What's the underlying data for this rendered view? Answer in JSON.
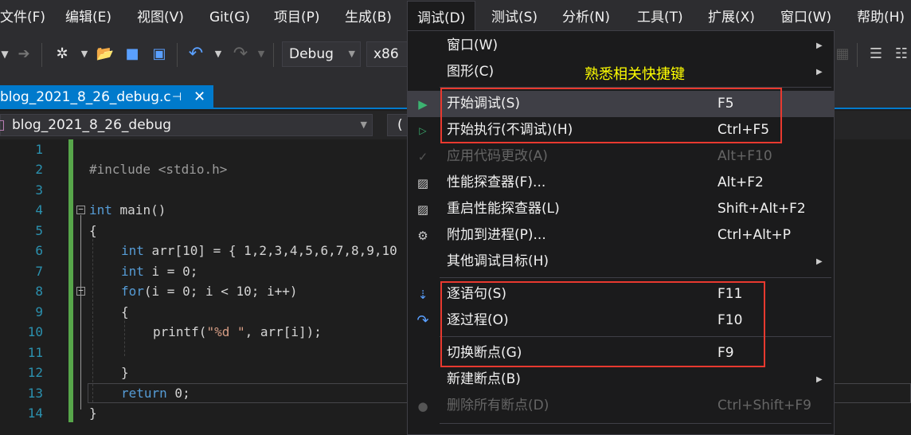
{
  "menubar": {
    "items": [
      "文件(F)",
      "编辑(E)",
      "视图(V)",
      "Git(G)",
      "项目(P)",
      "生成(B)",
      "调试(D)",
      "测试(S)",
      "分析(N)",
      "工具(T)",
      "扩展(X)",
      "窗口(W)",
      "帮助(H)"
    ]
  },
  "toolbar": {
    "config": "Debug",
    "platform": "x86"
  },
  "tab": {
    "title": "blog_2021_8_26_debug.c",
    "pin_glyph": "⊣",
    "close_glyph": "✕"
  },
  "navbar": {
    "scope": "blog_2021_8_26_debug",
    "member": "("
  },
  "editor": {
    "line_numbers": [
      "1",
      "2",
      "3",
      "4",
      "5",
      "6",
      "7",
      "8",
      "9",
      "10",
      "11",
      "12",
      "13",
      "14"
    ],
    "lines": {
      "l2": "#include <stdio.h>",
      "l4a": "int",
      "l4b": " main()",
      "l5": "{",
      "l6a": "int",
      "l6b": " arr[10] = { 1,2,3,4,5,6,7,8,9,10",
      "l7a": "int",
      "l7b": " i = 0;",
      "l8a": "for",
      "l8b": "(i = 0; i < 10; i++)",
      "l9": "{",
      "l10a": "printf(",
      "l10b": "\"%d \"",
      "l10c": ", arr[i]);",
      "l12": "}",
      "l13a": "return",
      "l13b": " 0;",
      "l14": "}"
    }
  },
  "debug_menu": {
    "title": "调试(D)",
    "annotation": "熟悉相关快捷键",
    "items": [
      {
        "label": "窗口(W)",
        "shortcut": ""
      },
      {
        "label": "图形(C)",
        "shortcut": ""
      },
      {
        "label": "开始调试(S)",
        "shortcut": "F5"
      },
      {
        "label": "开始执行(不调试)(H)",
        "shortcut": "Ctrl+F5"
      },
      {
        "label": "应用代码更改(A)",
        "shortcut": "Alt+F10"
      },
      {
        "label": "性能探查器(F)...",
        "shortcut": "Alt+F2"
      },
      {
        "label": "重启性能探查器(L)",
        "shortcut": "Shift+Alt+F2"
      },
      {
        "label": "附加到进程(P)...",
        "shortcut": "Ctrl+Alt+P"
      },
      {
        "label": "其他调试目标(H)",
        "shortcut": ""
      },
      {
        "label": "逐语句(S)",
        "shortcut": "F11"
      },
      {
        "label": "逐过程(O)",
        "shortcut": "F10"
      },
      {
        "label": "切换断点(G)",
        "shortcut": "F9"
      },
      {
        "label": "新建断点(B)",
        "shortcut": ""
      },
      {
        "label": "删除所有断点(D)",
        "shortcut": "Ctrl+Shift+F9"
      }
    ],
    "submenu_arrow": "▶"
  },
  "colors": {
    "accent": "#007acc",
    "highlight_box": "#e8392f",
    "annotation": "#ffff00",
    "play_green": "#3cb371"
  }
}
